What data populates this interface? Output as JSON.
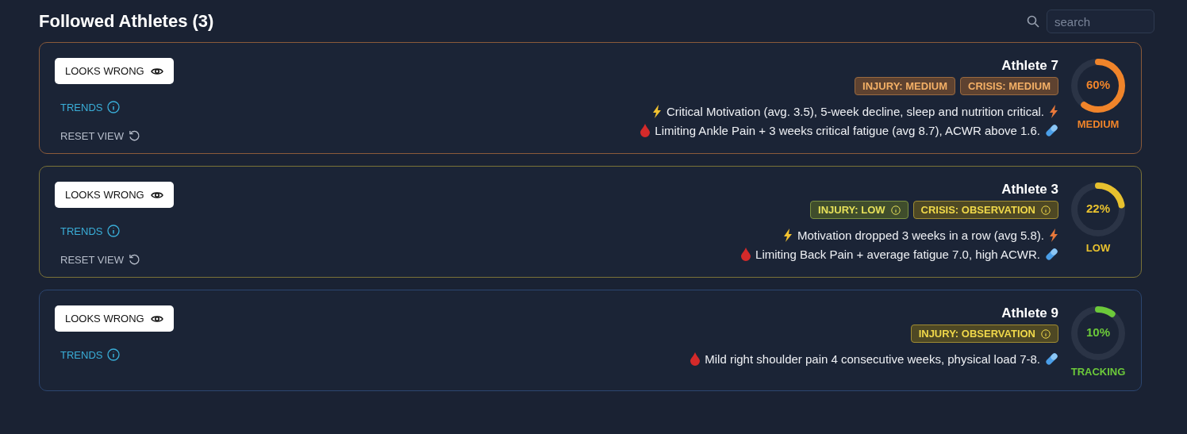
{
  "header": {
    "title": "Followed Athletes (3)",
    "search": {
      "placeholder": "search"
    }
  },
  "athletes": [
    {
      "name": "Athlete 7",
      "kind": "medium",
      "level": 0.6,
      "percent": "60%",
      "status": "MEDIUM",
      "actions": {
        "looks_wrong": "LOOKS WRONG",
        "trends": "TRENDS",
        "reset_view": "RESET VIEW"
      },
      "tags": [
        {
          "label": "INJURY: MEDIUM",
          "kind": "medium",
          "info": false
        },
        {
          "label": "CRISIS: MEDIUM",
          "kind": "medium",
          "info": false
        }
      ],
      "notes": [
        {
          "kind": "motivation",
          "text": "Critical Motivation (avg. 3.5), 5-week decline, sleep and nutrition critical."
        },
        {
          "kind": "pain",
          "text": "Limiting Ankle Pain + 3 weeks critical fatigue (avg 8.7), ACWR above 1.6."
        }
      ]
    },
    {
      "name": "Athlete 3",
      "kind": "low",
      "level": 0.22,
      "percent": "22%",
      "status": "LOW",
      "actions": {
        "looks_wrong": "LOOKS WRONG",
        "trends": "TRENDS",
        "reset_view": "RESET VIEW"
      },
      "tags": [
        {
          "label": "INJURY: LOW",
          "kind": "low",
          "info": true
        },
        {
          "label": "CRISIS: OBSERVATION",
          "kind": "observation",
          "info": true
        }
      ],
      "notes": [
        {
          "kind": "motivation",
          "text": "Motivation dropped 3 weeks in a row (avg 5.8)."
        },
        {
          "kind": "pain",
          "text": "Limiting Back Pain + average fatigue 7.0, high ACWR."
        }
      ]
    },
    {
      "name": "Athlete 9",
      "kind": "tracking",
      "level": 0.1,
      "percent": "10%",
      "status": "TRACKING",
      "actions": {
        "looks_wrong": "LOOKS WRONG",
        "trends": "TRENDS"
      },
      "tags": [
        {
          "label": "INJURY: OBSERVATION",
          "kind": "observation",
          "info": true
        }
      ],
      "notes": [
        {
          "kind": "pain",
          "text": "Mild right shoulder pain 4 consecutive weeks, physical load 7-8."
        }
      ]
    }
  ]
}
